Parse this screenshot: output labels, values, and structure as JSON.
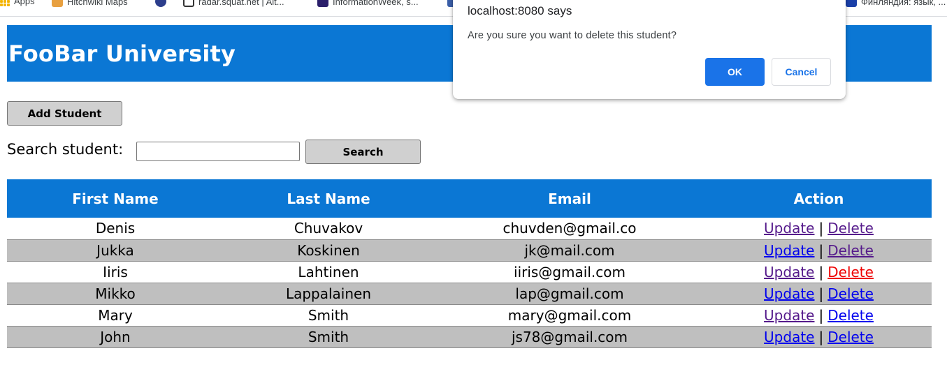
{
  "bookmarks": [
    {
      "label": "Apps",
      "icon": "apps-grid-icon",
      "color": "#f4b400"
    },
    {
      "label": "Hitchwiki Maps",
      "icon": "thumb-icon",
      "color": "#e8a040"
    },
    {
      "label": "",
      "icon": "cs-icon",
      "color": "#2c3e8c"
    },
    {
      "label": "radar.squat.net | Alt...",
      "icon": "radar-icon",
      "color": "#333333"
    },
    {
      "label": "InformationWeek, s...",
      "icon": "iw-icon",
      "color": "#2b1f6b"
    },
    {
      "label": "",
      "icon": "bookmark-icon",
      "color": "#3a5ea8"
    },
    {
      "label": "Финляндия: язык, ...",
      "icon": "flag-icon",
      "color": "#1a3fa8"
    }
  ],
  "header": {
    "title": "FooBar University",
    "bg": "#0b77d4"
  },
  "toolbar": {
    "add_label": "Add Student",
    "search_label": "Search student:",
    "search_value": "",
    "search_button": "Search"
  },
  "table": {
    "headers": [
      "First Name",
      "Last Name",
      "Email",
      "Action"
    ],
    "update_label": "Update",
    "delete_label": "Delete",
    "separator": "|",
    "rows": [
      {
        "first": "Denis",
        "last": "Chuvakov",
        "email": "chuvden@gmail.co",
        "update_color": "#551a8b",
        "delete_color": "#551a8b"
      },
      {
        "first": "Jukka",
        "last": "Koskinen",
        "email": "jk@mail.com",
        "update_color": "#0000ee",
        "delete_color": "#551a8b"
      },
      {
        "first": "Iiris",
        "last": "Lahtinen",
        "email": "iiris@gmail.com",
        "update_color": "#551a8b",
        "delete_color": "#ee0000"
      },
      {
        "first": "Mikko",
        "last": "Lappalainen",
        "email": "lap@gmail.com",
        "update_color": "#0000ee",
        "delete_color": "#0000ee"
      },
      {
        "first": "Mary",
        "last": "Smith",
        "email": "mary@gmail.com",
        "update_color": "#551a8b",
        "delete_color": "#0000ee"
      },
      {
        "first": "John",
        "last": "Smith",
        "email": "js78@gmail.com",
        "update_color": "#0000ee",
        "delete_color": "#0000ee"
      }
    ]
  },
  "dialog": {
    "title": "localhost:8080 says",
    "message": "Are you sure you want to delete this student?",
    "ok_label": "OK",
    "cancel_label": "Cancel",
    "accent": "#1a73e8"
  }
}
